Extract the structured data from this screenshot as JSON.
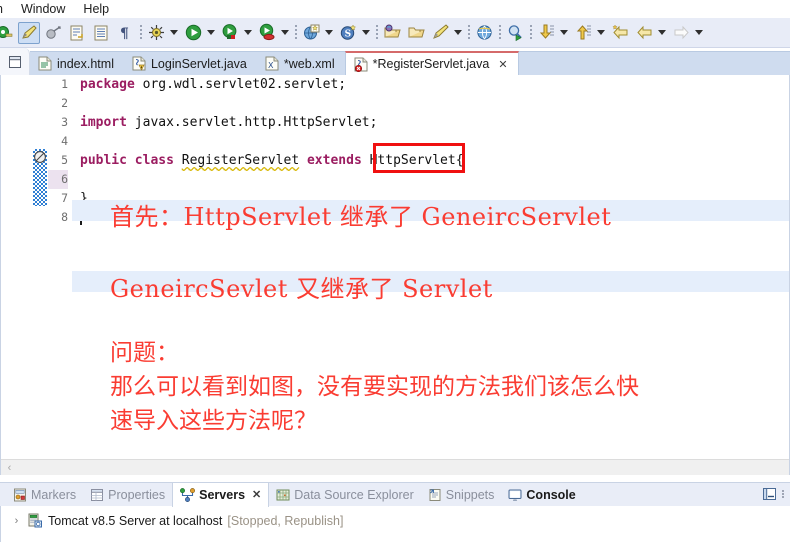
{
  "menu": {
    "items": [
      {
        "label": "n",
        "clipped": true
      },
      {
        "label": "Window"
      },
      {
        "label": "Help"
      }
    ]
  },
  "toolbar": {
    "groups": [
      {
        "buttons": [
          {
            "name": "new-wizard-icon",
            "glyph": "new-green"
          },
          {
            "name": "edit-highlight-icon",
            "glyph": "pen",
            "selected": true
          },
          {
            "name": "skip-breakpoints-icon",
            "glyph": "gray-ball"
          },
          {
            "name": "next-annotation-icon",
            "glyph": "doc-arrow"
          },
          {
            "name": "toggle-block-selection-icon",
            "glyph": "doc-lines"
          },
          {
            "name": "show-whitespace-icon",
            "glyph": "pilcrow"
          }
        ]
      },
      {
        "buttons": [
          {
            "name": "debug-icon",
            "glyph": "bug",
            "arrow": true
          },
          {
            "name": "run-icon",
            "glyph": "run-green",
            "arrow": true
          },
          {
            "name": "run-as-server-icon",
            "glyph": "run-server",
            "arrow": true
          },
          {
            "name": "run-coverage-icon",
            "glyph": "run-coverage",
            "arrow": true
          }
        ]
      },
      {
        "buttons": [
          {
            "name": "new-web-project-icon",
            "glyph": "globe-new",
            "arrow": true
          },
          {
            "name": "new-spring-icon",
            "glyph": "spring-s",
            "arrow": true
          }
        ]
      },
      {
        "buttons": [
          {
            "name": "open-package-icon",
            "glyph": "folder-ball"
          },
          {
            "name": "open-folder-icon",
            "glyph": "folder-open"
          },
          {
            "name": "new-java-class-icon",
            "glyph": "pen-yellow",
            "arrow": true
          }
        ]
      },
      {
        "buttons": [
          {
            "name": "open-browser-icon",
            "glyph": "globe"
          }
        ]
      },
      {
        "buttons": [
          {
            "name": "search-icon",
            "glyph": "search-run"
          }
        ]
      },
      {
        "buttons": [
          {
            "name": "previous-edit-icon",
            "glyph": "down-yellow",
            "arrow": true
          },
          {
            "name": "next-edit-icon",
            "glyph": "up-yellow",
            "arrow": true
          },
          {
            "name": "back-annotation-icon",
            "glyph": "arrow-left-star"
          },
          {
            "name": "back-icon",
            "glyph": "arrow-left",
            "arrow": true
          },
          {
            "name": "forward-icon",
            "glyph": "arrow-right-dim",
            "arrow": true
          }
        ]
      }
    ]
  },
  "editor": {
    "view_menu_label": "view-menu",
    "tabs": [
      {
        "label": "index.html",
        "icon": "html-file-icon",
        "active": false,
        "dirty": false
      },
      {
        "label": "LoginServlet.java",
        "icon": "java-warning-file-icon",
        "active": false,
        "dirty": false
      },
      {
        "label": "*web.xml",
        "icon": "xml-file-icon",
        "active": false,
        "dirty": true
      },
      {
        "label": "*RegisterServlet.java",
        "icon": "java-error-file-icon",
        "active": true,
        "dirty": true,
        "close": "✕"
      }
    ],
    "line_numbers": [
      "1",
      "2",
      "3",
      "4",
      "5",
      "6",
      "7",
      "8"
    ],
    "code_lines": [
      {
        "n": 1,
        "tokens": [
          {
            "t": "package ",
            "c": "kw"
          },
          {
            "t": "org.wdl.servlet02.servlet;",
            "c": ""
          }
        ]
      },
      {
        "n": 2,
        "tokens": []
      },
      {
        "n": 3,
        "tokens": [
          {
            "t": "import ",
            "c": "kw"
          },
          {
            "t": "javax.servlet.http.HttpServlet;",
            "c": ""
          }
        ]
      },
      {
        "n": 4,
        "tokens": []
      },
      {
        "n": 5,
        "tokens": [
          {
            "t": "public class ",
            "c": "kw"
          },
          {
            "t": "RegisterServlet",
            "c": "typ"
          },
          {
            "t": " ",
            "c": ""
          },
          {
            "t": "extends",
            "c": "kw"
          },
          {
            "t": " HttpServlet{",
            "c": ""
          }
        ]
      },
      {
        "n": 6,
        "tokens": []
      },
      {
        "n": 7,
        "tokens": [
          {
            "t": "}",
            "c": ""
          }
        ]
      },
      {
        "n": 8,
        "tokens": []
      }
    ],
    "error_marker": "error-marker-icon",
    "highlight_color": "#f01010",
    "scroll_left_label": "‹"
  },
  "annotations": {
    "line1": "首先：HttpServlet 继承了 GeneircServlet",
    "line2": "GeneircSevlet 又继承了 Servlet",
    "line3": "问题：",
    "line4": "那么可以看到如图，没有要实现的方法我们该怎么快",
    "line5": "速导入这些方法呢？",
    "color": "#fa3c32"
  },
  "bottom_panel": {
    "tabs": [
      {
        "label": "Markers",
        "icon": "markers-icon",
        "active": false
      },
      {
        "label": "Properties",
        "icon": "properties-icon",
        "active": false
      },
      {
        "label": "Servers",
        "icon": "servers-icon",
        "active": true,
        "close": "✕"
      },
      {
        "label": "Data Source Explorer",
        "icon": "data-source-icon",
        "active": false
      },
      {
        "label": "Snippets",
        "icon": "snippets-icon",
        "active": false
      },
      {
        "label": "Console",
        "icon": "console-icon",
        "active": false,
        "bold": true
      }
    ],
    "actions": [
      {
        "name": "minimize-button",
        "glyph": "minimize"
      },
      {
        "name": "view-menu-button",
        "glyph": "dots"
      }
    ],
    "tree": [
      {
        "twisty": "›",
        "icon": "tomcat-server-icon",
        "name": "Tomcat v8.5 Server at localhost",
        "state": "[Stopped, Republish]"
      }
    ]
  }
}
